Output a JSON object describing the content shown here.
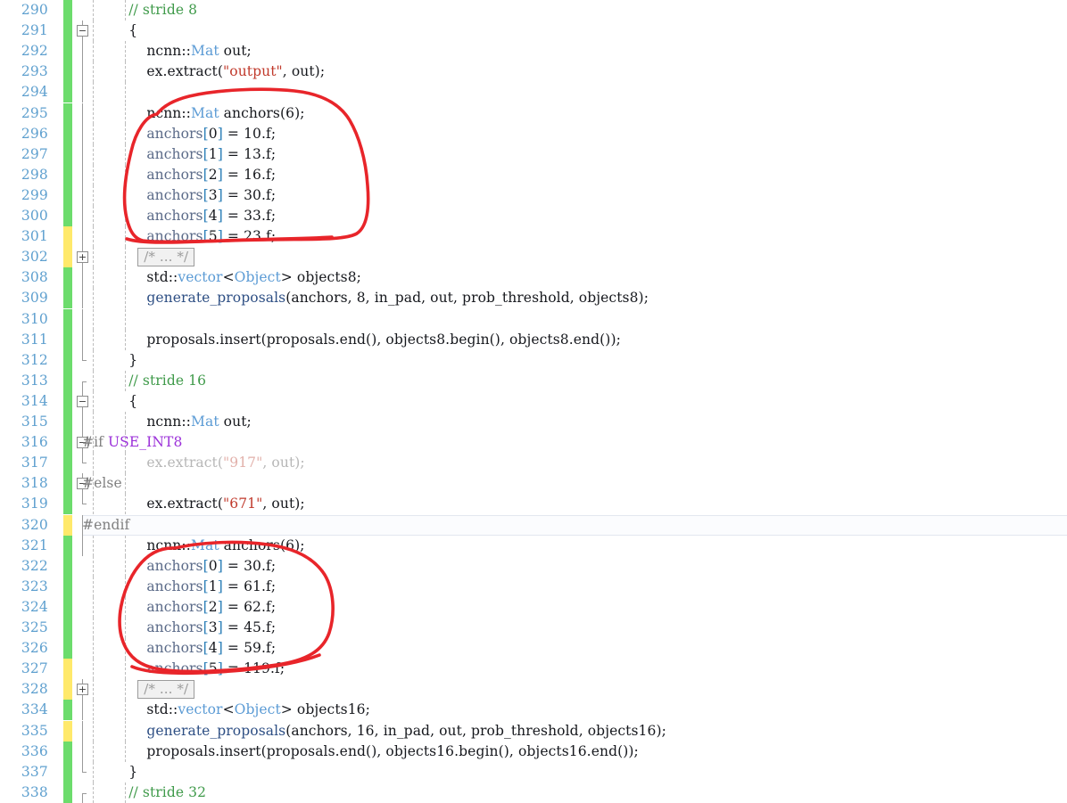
{
  "editor": {
    "language": "cpp",
    "gutter_colors": {
      "modified": "#ffe96b",
      "added": "#6cdc6c"
    },
    "current_line": 320,
    "annotation_color": "#e8252a"
  },
  "lines": [
    {
      "number": "290",
      "mark": "green",
      "indent_guides": [
        0,
        36
      ],
      "fold": "none",
      "tokens": [
        {
          "t": "        ",
          "c": "plain"
        },
        {
          "t": "// stride 8",
          "c": "cmt"
        }
      ]
    },
    {
      "number": "291",
      "mark": "green",
      "indent_guides": [
        0
      ],
      "fold": "minus",
      "tokens": [
        {
          "t": "        {",
          "c": "plain"
        }
      ]
    },
    {
      "number": "292",
      "mark": "green",
      "indent_guides": [
        0,
        36
      ],
      "fold": "line",
      "tokens": [
        {
          "t": "            ",
          "c": "plain"
        },
        {
          "t": "ncnn::",
          "c": "plain"
        },
        {
          "t": "Mat",
          "c": "type"
        },
        {
          "t": " out;",
          "c": "plain"
        }
      ]
    },
    {
      "number": "293",
      "mark": "green",
      "indent_guides": [
        0,
        36
      ],
      "fold": "line",
      "tokens": [
        {
          "t": "            ",
          "c": "plain"
        },
        {
          "t": "ex.extract(",
          "c": "plain"
        },
        {
          "t": "\"output\"",
          "c": "str"
        },
        {
          "t": ", out);",
          "c": "plain"
        }
      ]
    },
    {
      "number": "294",
      "mark": "green",
      "indent_guides": [
        0,
        36
      ],
      "fold": "line",
      "tokens": []
    },
    {
      "number": "295",
      "mark": "green",
      "indent_guides": [
        0,
        36
      ],
      "fold": "line",
      "tokens": [
        {
          "t": "            ",
          "c": "plain"
        },
        {
          "t": "ncnn::",
          "c": "plain"
        },
        {
          "t": "Mat",
          "c": "type"
        },
        {
          "t": " anchors(",
          "c": "plain"
        },
        {
          "t": "6",
          "c": "num"
        },
        {
          "t": ");",
          "c": "plain"
        }
      ]
    },
    {
      "number": "296",
      "mark": "green",
      "indent_guides": [
        0,
        36
      ],
      "fold": "line",
      "tokens": [
        {
          "t": "            ",
          "c": "plain"
        },
        {
          "t": "anchors",
          "c": "var"
        },
        {
          "t": "[",
          "c": "brk"
        },
        {
          "t": "0",
          "c": "num"
        },
        {
          "t": "]",
          "c": "brk"
        },
        {
          "t": " = ",
          "c": "plain"
        },
        {
          "t": "10.f",
          "c": "num"
        },
        {
          "t": ";",
          "c": "plain"
        }
      ]
    },
    {
      "number": "297",
      "mark": "green",
      "indent_guides": [
        0,
        36
      ],
      "fold": "line",
      "tokens": [
        {
          "t": "            ",
          "c": "plain"
        },
        {
          "t": "anchors",
          "c": "var"
        },
        {
          "t": "[",
          "c": "brk"
        },
        {
          "t": "1",
          "c": "num"
        },
        {
          "t": "]",
          "c": "brk"
        },
        {
          "t": " = ",
          "c": "plain"
        },
        {
          "t": "13.f",
          "c": "num"
        },
        {
          "t": ";",
          "c": "plain"
        }
      ]
    },
    {
      "number": "298",
      "mark": "green",
      "indent_guides": [
        0,
        36
      ],
      "fold": "line",
      "tokens": [
        {
          "t": "            ",
          "c": "plain"
        },
        {
          "t": "anchors",
          "c": "var"
        },
        {
          "t": "[",
          "c": "brk"
        },
        {
          "t": "2",
          "c": "num"
        },
        {
          "t": "]",
          "c": "brk"
        },
        {
          "t": " = ",
          "c": "plain"
        },
        {
          "t": "16.f",
          "c": "num"
        },
        {
          "t": ";",
          "c": "plain"
        }
      ]
    },
    {
      "number": "299",
      "mark": "green",
      "indent_guides": [
        0,
        36
      ],
      "fold": "line",
      "tokens": [
        {
          "t": "            ",
          "c": "plain"
        },
        {
          "t": "anchors",
          "c": "var"
        },
        {
          "t": "[",
          "c": "brk"
        },
        {
          "t": "3",
          "c": "num"
        },
        {
          "t": "]",
          "c": "brk"
        },
        {
          "t": " = ",
          "c": "plain"
        },
        {
          "t": "30.f",
          "c": "num"
        },
        {
          "t": ";",
          "c": "plain"
        }
      ]
    },
    {
      "number": "300",
      "mark": "green",
      "indent_guides": [
        0,
        36
      ],
      "fold": "line",
      "tokens": [
        {
          "t": "            ",
          "c": "plain"
        },
        {
          "t": "anchors",
          "c": "var"
        },
        {
          "t": "[",
          "c": "brk"
        },
        {
          "t": "4",
          "c": "num"
        },
        {
          "t": "]",
          "c": "brk"
        },
        {
          "t": " = ",
          "c": "plain"
        },
        {
          "t": "33.f",
          "c": "num"
        },
        {
          "t": ";",
          "c": "plain"
        }
      ]
    },
    {
      "number": "301",
      "mark": "yellow",
      "indent_guides": [
        0,
        36
      ],
      "fold": "line",
      "tokens": [
        {
          "t": "            ",
          "c": "plain"
        },
        {
          "t": "anchors",
          "c": "var"
        },
        {
          "t": "[",
          "c": "brk"
        },
        {
          "t": "5",
          "c": "num"
        },
        {
          "t": "]",
          "c": "brk"
        },
        {
          "t": " = ",
          "c": "plain"
        },
        {
          "t": "23.f",
          "c": "num"
        },
        {
          "t": ";",
          "c": "plain"
        }
      ]
    },
    {
      "number": "302",
      "mark": "yellow",
      "indent_guides": [
        0,
        36
      ],
      "fold": "plus",
      "collapsed_placeholder": "/* ... */",
      "tokens": []
    },
    {
      "number": "308",
      "mark": "green",
      "indent_guides": [
        0,
        36
      ],
      "fold": "line",
      "tokens": [
        {
          "t": "            ",
          "c": "plain"
        },
        {
          "t": "std::",
          "c": "plain"
        },
        {
          "t": "vector",
          "c": "type"
        },
        {
          "t": "<",
          "c": "plain"
        },
        {
          "t": "Object",
          "c": "type"
        },
        {
          "t": "> objects8;",
          "c": "plain"
        }
      ]
    },
    {
      "number": "309",
      "mark": "green",
      "indent_guides": [
        0,
        36
      ],
      "fold": "line",
      "tokens": [
        {
          "t": "            ",
          "c": "plain"
        },
        {
          "t": "generate_proposals",
          "c": "fn"
        },
        {
          "t": "(anchors, ",
          "c": "plain"
        },
        {
          "t": "8",
          "c": "num"
        },
        {
          "t": ", in_pad, out, prob_threshold, objects8);",
          "c": "plain"
        }
      ]
    },
    {
      "number": "310",
      "mark": "green",
      "indent_guides": [
        0,
        36
      ],
      "fold": "line",
      "tokens": []
    },
    {
      "number": "311",
      "mark": "green",
      "indent_guides": [
        0,
        36
      ],
      "fold": "line",
      "tokens": [
        {
          "t": "            ",
          "c": "plain"
        },
        {
          "t": "proposals.insert(proposals.end(), objects8.begin(), objects8.end());",
          "c": "plain"
        }
      ]
    },
    {
      "number": "312",
      "mark": "green",
      "indent_guides": [
        0
      ],
      "fold": "line-end",
      "tokens": [
        {
          "t": "        }",
          "c": "plain"
        }
      ]
    },
    {
      "number": "313",
      "mark": "green",
      "indent_guides": [
        0,
        36
      ],
      "fold": "cap-top",
      "tokens": [
        {
          "t": "        ",
          "c": "plain"
        },
        {
          "t": "// stride 16",
          "c": "cmt"
        }
      ]
    },
    {
      "number": "314",
      "mark": "green",
      "indent_guides": [
        0
      ],
      "fold": "minus",
      "tokens": [
        {
          "t": "        {",
          "c": "plain"
        }
      ]
    },
    {
      "number": "315",
      "mark": "green",
      "indent_guides": [
        0,
        36
      ],
      "fold": "line",
      "tokens": [
        {
          "t": "            ",
          "c": "plain"
        },
        {
          "t": "ncnn::",
          "c": "plain"
        },
        {
          "t": "Mat",
          "c": "type"
        },
        {
          "t": " out;",
          "c": "plain"
        }
      ]
    },
    {
      "number": "316",
      "mark": "green",
      "indent_guides": [
        0,
        36
      ],
      "fold": "minus",
      "no_indent": true,
      "tokens": [
        {
          "t": "#if ",
          "c": "pp"
        },
        {
          "t": "USE_INT8",
          "c": "macro"
        }
      ]
    },
    {
      "number": "317",
      "mark": "green",
      "indent_guides": [
        0,
        36
      ],
      "fold": "cap-bot",
      "tokens": [
        {
          "t": "            ",
          "c": "plain"
        },
        {
          "t": "ex.extract(",
          "c": "dim"
        },
        {
          "t": "\"917\"",
          "c": "dimstr"
        },
        {
          "t": ", out);",
          "c": "dim"
        }
      ]
    },
    {
      "number": "318",
      "mark": "green",
      "indent_guides": [
        0,
        36
      ],
      "fold": "minus",
      "no_indent": true,
      "tokens": [
        {
          "t": "#else",
          "c": "pp"
        }
      ]
    },
    {
      "number": "319",
      "mark": "green",
      "indent_guides": [
        0,
        36
      ],
      "fold": "cap-bot",
      "tokens": [
        {
          "t": "            ",
          "c": "plain"
        },
        {
          "t": "ex.extract(",
          "c": "plain"
        },
        {
          "t": "\"671\"",
          "c": "str"
        },
        {
          "t": ", out);",
          "c": "plain"
        }
      ]
    },
    {
      "number": "320",
      "mark": "yellow",
      "indent_guides": [],
      "fold": "line",
      "current": true,
      "no_indent": true,
      "tokens": [
        {
          "t": "#endif",
          "c": "pp"
        }
      ]
    },
    {
      "number": "321",
      "mark": "green",
      "indent_guides": [
        0,
        36
      ],
      "fold": "line",
      "tokens": [
        {
          "t": "            ",
          "c": "plain"
        },
        {
          "t": "ncnn::",
          "c": "plain"
        },
        {
          "t": "Mat",
          "c": "type"
        },
        {
          "t": " anchors(",
          "c": "plain"
        },
        {
          "t": "6",
          "c": "num"
        },
        {
          "t": ");",
          "c": "plain"
        }
      ]
    },
    {
      "number": "322",
      "mark": "green",
      "indent_guides": [
        0,
        36
      ],
      "fold": "none",
      "tokens": [
        {
          "t": "            ",
          "c": "plain"
        },
        {
          "t": "anchors",
          "c": "var"
        },
        {
          "t": "[",
          "c": "brk"
        },
        {
          "t": "0",
          "c": "num"
        },
        {
          "t": "]",
          "c": "brk"
        },
        {
          "t": " = ",
          "c": "plain"
        },
        {
          "t": "30.f",
          "c": "num"
        },
        {
          "t": ";",
          "c": "plain"
        }
      ]
    },
    {
      "number": "323",
      "mark": "green",
      "indent_guides": [
        0,
        36
      ],
      "fold": "none",
      "tokens": [
        {
          "t": "            ",
          "c": "plain"
        },
        {
          "t": "anchors",
          "c": "var"
        },
        {
          "t": "[",
          "c": "brk"
        },
        {
          "t": "1",
          "c": "num"
        },
        {
          "t": "]",
          "c": "brk"
        },
        {
          "t": " = ",
          "c": "plain"
        },
        {
          "t": "61.f",
          "c": "num"
        },
        {
          "t": ";",
          "c": "plain"
        }
      ]
    },
    {
      "number": "324",
      "mark": "green",
      "indent_guides": [
        0,
        36
      ],
      "fold": "none",
      "tokens": [
        {
          "t": "            ",
          "c": "plain"
        },
        {
          "t": "anchors",
          "c": "var"
        },
        {
          "t": "[",
          "c": "brk"
        },
        {
          "t": "2",
          "c": "num"
        },
        {
          "t": "]",
          "c": "brk"
        },
        {
          "t": " = ",
          "c": "plain"
        },
        {
          "t": "62.f",
          "c": "num"
        },
        {
          "t": ";",
          "c": "plain"
        }
      ]
    },
    {
      "number": "325",
      "mark": "green",
      "indent_guides": [
        0,
        36
      ],
      "fold": "none",
      "tokens": [
        {
          "t": "            ",
          "c": "plain"
        },
        {
          "t": "anchors",
          "c": "var"
        },
        {
          "t": "[",
          "c": "brk"
        },
        {
          "t": "3",
          "c": "num"
        },
        {
          "t": "]",
          "c": "brk"
        },
        {
          "t": " = ",
          "c": "plain"
        },
        {
          "t": "45.f",
          "c": "num"
        },
        {
          "t": ";",
          "c": "plain"
        }
      ]
    },
    {
      "number": "326",
      "mark": "green",
      "indent_guides": [
        0,
        36
      ],
      "fold": "none",
      "tokens": [
        {
          "t": "            ",
          "c": "plain"
        },
        {
          "t": "anchors",
          "c": "var"
        },
        {
          "t": "[",
          "c": "brk"
        },
        {
          "t": "4",
          "c": "num"
        },
        {
          "t": "]",
          "c": "brk"
        },
        {
          "t": " = ",
          "c": "plain"
        },
        {
          "t": "59.f",
          "c": "num"
        },
        {
          "t": ";",
          "c": "plain"
        }
      ]
    },
    {
      "number": "327",
      "mark": "yellow",
      "indent_guides": [
        0,
        36
      ],
      "fold": "none",
      "tokens": [
        {
          "t": "            ",
          "c": "plain"
        },
        {
          "t": "anchors",
          "c": "var"
        },
        {
          "t": "[",
          "c": "brk"
        },
        {
          "t": "5",
          "c": "num"
        },
        {
          "t": "]",
          "c": "brk"
        },
        {
          "t": " = ",
          "c": "plain"
        },
        {
          "t": "119.f",
          "c": "num"
        },
        {
          "t": ";",
          "c": "plain"
        }
      ]
    },
    {
      "number": "328",
      "mark": "yellow",
      "indent_guides": [
        0,
        36
      ],
      "fold": "plus",
      "collapsed_placeholder": "/* ... */",
      "tokens": []
    },
    {
      "number": "334",
      "mark": "green",
      "indent_guides": [
        0,
        36
      ],
      "fold": "line",
      "tokens": [
        {
          "t": "            ",
          "c": "plain"
        },
        {
          "t": "std::",
          "c": "plain"
        },
        {
          "t": "vector",
          "c": "type"
        },
        {
          "t": "<",
          "c": "plain"
        },
        {
          "t": "Object",
          "c": "type"
        },
        {
          "t": "> objects16;",
          "c": "plain"
        }
      ]
    },
    {
      "number": "335",
      "mark": "yellow",
      "indent_guides": [
        0,
        36
      ],
      "fold": "line",
      "tokens": [
        {
          "t": "            ",
          "c": "plain"
        },
        {
          "t": "generate_proposals",
          "c": "fn"
        },
        {
          "t": "(anchors, ",
          "c": "plain"
        },
        {
          "t": "16",
          "c": "num"
        },
        {
          "t": ", in_pad, out, prob_threshold, objects16);",
          "c": "plain"
        }
      ]
    },
    {
      "number": "336",
      "mark": "green",
      "indent_guides": [
        0,
        36
      ],
      "fold": "line",
      "tokens": [
        {
          "t": "            ",
          "c": "plain"
        },
        {
          "t": "proposals.insert(proposals.end(), objects16.begin(), objects16.end());",
          "c": "plain"
        }
      ]
    },
    {
      "number": "337",
      "mark": "green",
      "indent_guides": [
        0
      ],
      "fold": "line-end",
      "tokens": [
        {
          "t": "        }",
          "c": "plain"
        }
      ]
    },
    {
      "number": "338",
      "mark": "green",
      "indent_guides": [
        0,
        36
      ],
      "fold": "cap-top",
      "tokens": [
        {
          "t": "        ",
          "c": "plain"
        },
        {
          "t": "// stride 32",
          "c": "cmt"
        }
      ]
    }
  ],
  "annotations": [
    {
      "name": "red-circle-anchors-stride8",
      "shape": "hand-drawn-ellipse",
      "color": "#e8252a",
      "encloses_lines": [
        "295",
        "296",
        "297",
        "298",
        "299",
        "300",
        "301"
      ]
    },
    {
      "name": "red-circle-anchors-stride16",
      "shape": "hand-drawn-ellipse",
      "color": "#e8252a",
      "encloses_lines": [
        "322",
        "323",
        "324",
        "325",
        "326",
        "327"
      ]
    }
  ]
}
